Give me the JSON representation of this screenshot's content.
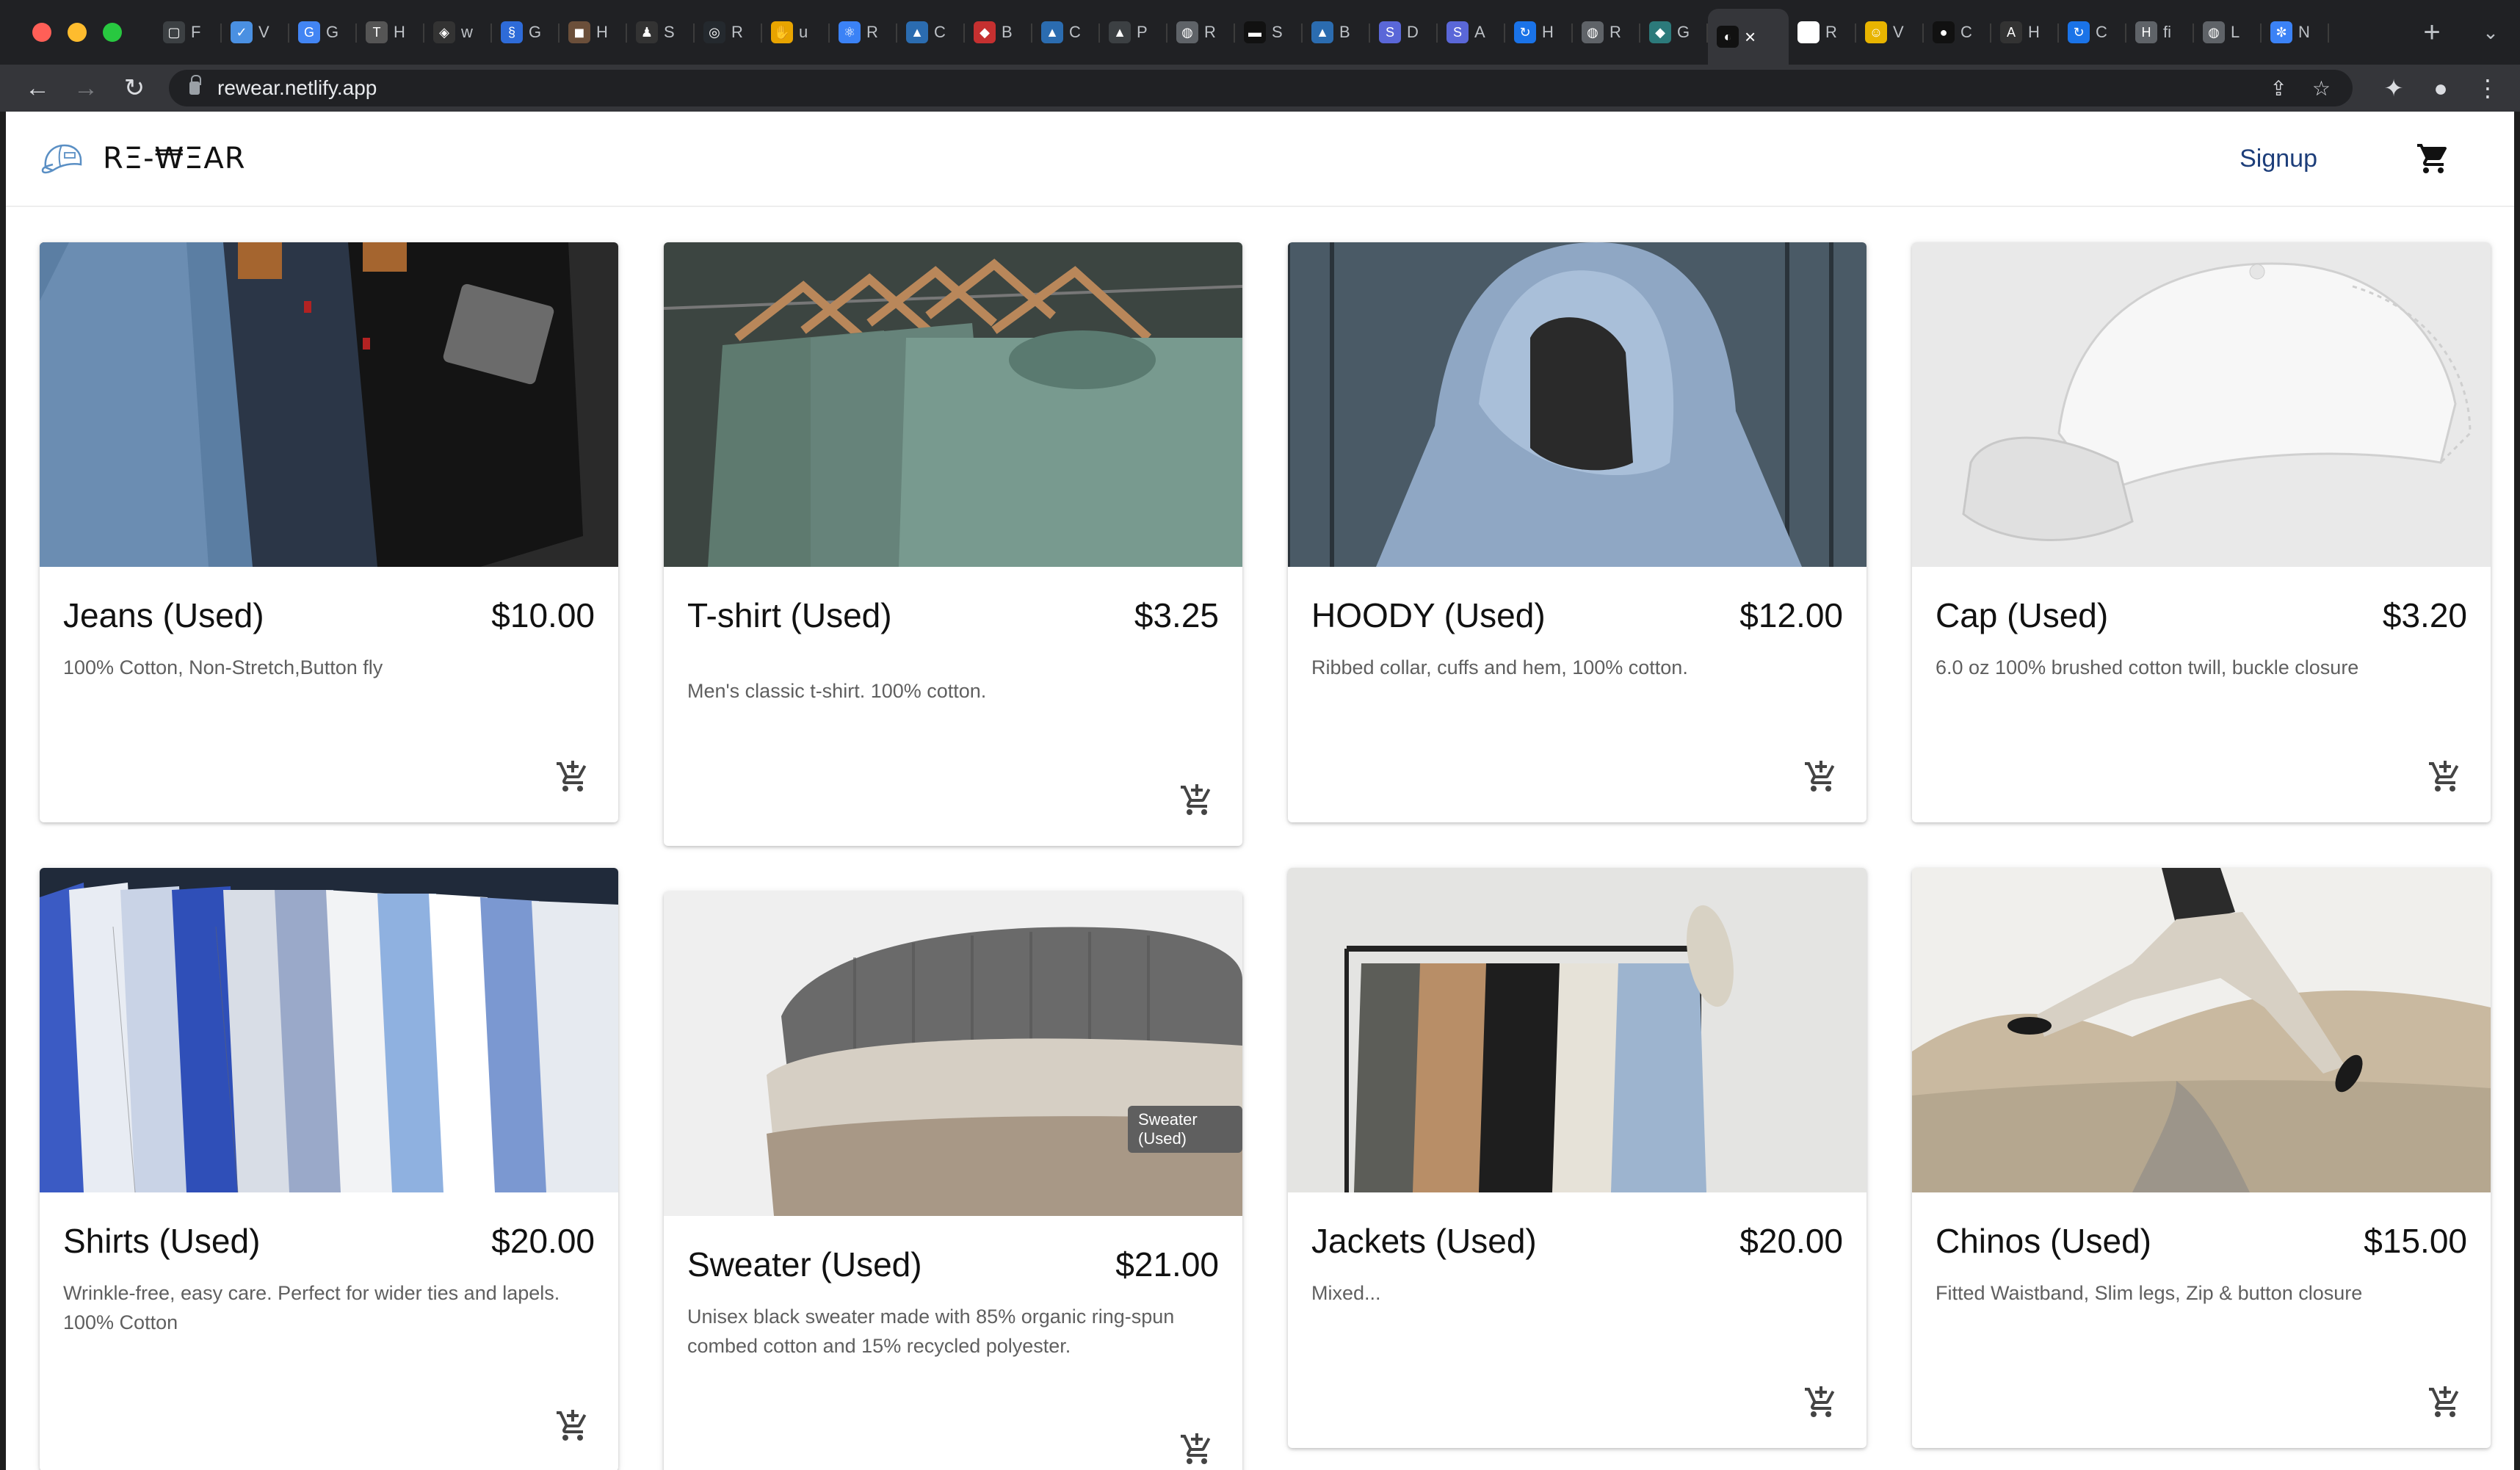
{
  "browser": {
    "tabs": [
      {
        "letter": "F",
        "color": "#3c4043",
        "glyph": "▢"
      },
      {
        "letter": "V",
        "color": "#4a90e2",
        "glyph": "✓"
      },
      {
        "letter": "G",
        "color": "#4285f4",
        "glyph": "G"
      },
      {
        "letter": "H",
        "color": "#555555",
        "glyph": "T"
      },
      {
        "letter": "w",
        "color": "#333333",
        "glyph": "◈"
      },
      {
        "letter": "G",
        "color": "#2e6bd8",
        "glyph": "§"
      },
      {
        "letter": "H",
        "color": "#6b4f3a",
        "glyph": "◼"
      },
      {
        "letter": "S",
        "color": "#333333",
        "glyph": "♟"
      },
      {
        "letter": "R",
        "color": "#24292e",
        "glyph": "◎"
      },
      {
        "letter": "u",
        "color": "#e8a400",
        "glyph": "✋"
      },
      {
        "letter": "R",
        "color": "#3b82f6",
        "glyph": "⚛"
      },
      {
        "letter": "C",
        "color": "#2b6cb0",
        "glyph": "▲"
      },
      {
        "letter": "B",
        "color": "#c53030",
        "glyph": "◆"
      },
      {
        "letter": "C",
        "color": "#2b6cb0",
        "glyph": "▲"
      },
      {
        "letter": "P",
        "color": "#3c4043",
        "glyph": "▲"
      },
      {
        "letter": "R",
        "color": "#5f6368",
        "glyph": "◍"
      },
      {
        "letter": "S",
        "color": "#111111",
        "glyph": "▬"
      },
      {
        "letter": "B",
        "color": "#2b6cb0",
        "glyph": "▲"
      },
      {
        "letter": "D",
        "color": "#5a67d8",
        "glyph": "S"
      },
      {
        "letter": "A",
        "color": "#5a67d8",
        "glyph": "S"
      },
      {
        "letter": "H",
        "color": "#1a73e8",
        "glyph": "↻"
      },
      {
        "letter": "R",
        "color": "#5f6368",
        "glyph": "◍"
      },
      {
        "letter": "G",
        "color": "#2c7a7b",
        "glyph": "◆"
      }
    ],
    "active_tab_glyph": "◐",
    "tabs_after": [
      {
        "letter": "R",
        "color": "#ffffff",
        "glyph": "◇"
      },
      {
        "letter": "V",
        "color": "#e8b400",
        "glyph": "☺"
      },
      {
        "letter": "C",
        "color": "#111111",
        "glyph": "●"
      },
      {
        "letter": "H",
        "color": "#333333",
        "glyph": "A"
      },
      {
        "letter": "C",
        "color": "#1a73e8",
        "glyph": "↻"
      },
      {
        "letter": "fi",
        "color": "#5f6368",
        "glyph": "H"
      },
      {
        "letter": "L",
        "color": "#5f6368",
        "glyph": "◍"
      },
      {
        "letter": "N",
        "color": "#3b82f6",
        "glyph": "✼"
      }
    ],
    "url": "rewear.netlify.app",
    "new_tab": "+"
  },
  "app": {
    "brand": "RΞ-₩ΞAR",
    "signup": "Signup",
    "accent": "#1d3e7a"
  },
  "products": [
    {
      "title": "Jeans (Used)",
      "price": "$10.00",
      "description": "100% Cotton, Non-Stretch,Button fly"
    },
    {
      "title": "T-shirt (Used)",
      "price": "$3.25",
      "description": "Men's classic t-shirt. 100% cotton."
    },
    {
      "title": "HOODY (Used)",
      "price": "$12.00",
      "description": "Ribbed collar, cuffs and hem, 100% cotton."
    },
    {
      "title": "Cap (Used)",
      "price": "$3.20",
      "description": "6.0 oz 100% brushed cotton twill, buckle closure"
    },
    {
      "title": "Shirts (Used)",
      "price": "$20.00",
      "description": "Wrinkle-free, easy care. Perfect for wider ties and lapels. 100% Cotton"
    },
    {
      "title": "Sweater (Used)",
      "price": "$21.00",
      "description": "Unisex black sweater made with 85% organic ring-spun combed cotton and 15% recycled polyester."
    },
    {
      "title": "Jackets (Used)",
      "price": "$20.00",
      "description": "Mixed..."
    },
    {
      "title": "Chinos (Used)",
      "price": "$15.00",
      "description": "Fitted Waistband, Slim legs, Zip & button closure"
    }
  ],
  "tooltip": "Sweater (Used)"
}
